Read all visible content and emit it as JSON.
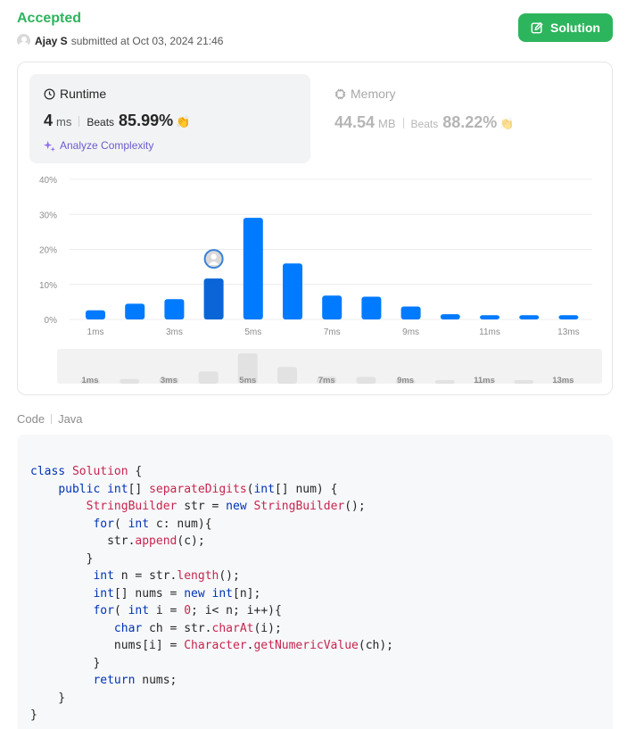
{
  "header": {
    "status": "Accepted",
    "user": "Ajay S",
    "submitted_text": "submitted at Oct 03, 2024 21:46",
    "solution_label": "Solution"
  },
  "runtime": {
    "title": "Runtime",
    "value": "4",
    "unit": "ms",
    "beats_label": "Beats",
    "beats": "85.99%",
    "analyze_label": "Analyze Complexity"
  },
  "memory": {
    "title": "Memory",
    "value": "44.54",
    "unit": "MB",
    "beats_label": "Beats",
    "beats": "88.22%"
  },
  "colors": {
    "accepted": "#2db55d",
    "bar": "#007aff",
    "bar_selected": "#0a66d6",
    "analyze": "#6b5bd2"
  },
  "chart_data": {
    "type": "bar",
    "y_ticks": [
      "40%",
      "30%",
      "20%",
      "10%",
      "0%"
    ],
    "ylim": [
      0,
      40
    ],
    "categories": [
      "1ms",
      "2ms",
      "3ms",
      "4ms",
      "5ms",
      "6ms",
      "7ms",
      "8ms",
      "9ms",
      "10ms",
      "11ms",
      "12ms",
      "13ms"
    ],
    "x_labels_shown": [
      "1ms",
      "3ms",
      "5ms",
      "7ms",
      "9ms",
      "11ms",
      "13ms"
    ],
    "values": [
      2.6,
      4.5,
      5.8,
      11.7,
      29.0,
      16.0,
      6.8,
      6.5,
      3.7,
      1.5,
      1.2,
      1.2,
      1.2
    ],
    "selected_index": 3,
    "grid": true
  },
  "code": {
    "label": "Code",
    "language": "Java"
  }
}
